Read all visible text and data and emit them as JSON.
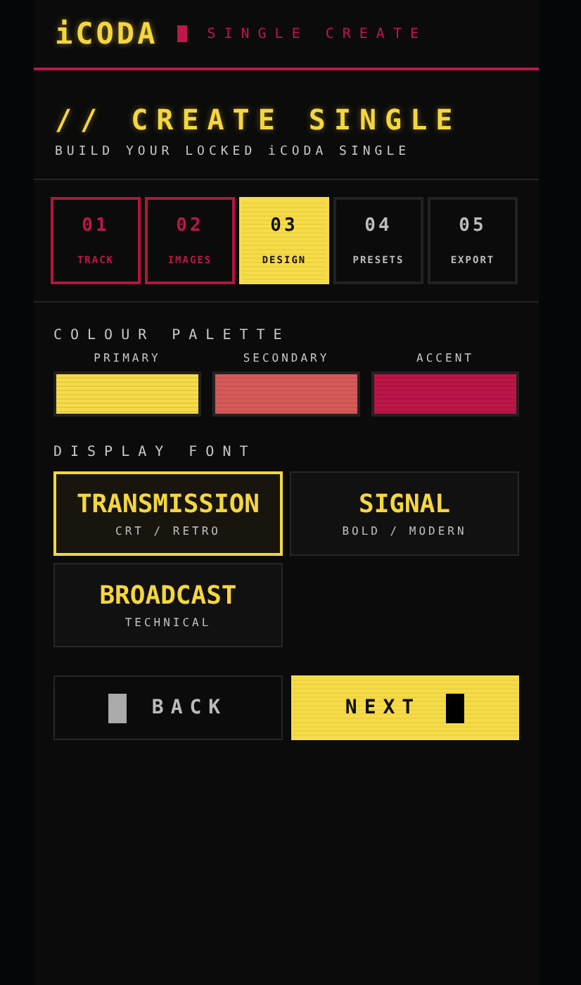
{
  "header": {
    "logo": "iCODA",
    "subtitle": "SINGLE CREATE"
  },
  "page": {
    "title": "// CREATE SINGLE",
    "subtitle": "BUILD YOUR LOCKED iCODA SINGLE"
  },
  "steps": [
    {
      "number": "01",
      "label": "TRACK",
      "done": true,
      "selected": false
    },
    {
      "number": "02",
      "label": "IMAGES",
      "done": true,
      "selected": false
    },
    {
      "number": "03",
      "label": "DESIGN",
      "done": false,
      "selected": true
    },
    {
      "number": "04",
      "label": "PRESETS",
      "done": false,
      "selected": false
    },
    {
      "number": "05",
      "label": "EXPORT",
      "done": false,
      "selected": false
    }
  ],
  "palette": {
    "label": "COLOUR PALETTE",
    "swatches": [
      {
        "name": "PRIMARY",
        "color": "#f7dc4a"
      },
      {
        "name": "SECONDARY",
        "color": "#d65a59"
      },
      {
        "name": "ACCENT",
        "color": "#bc1548"
      }
    ]
  },
  "fonts": {
    "label": "DISPLAY FONT",
    "options": [
      {
        "name": "TRANSMISSION",
        "style": "CRT / RETRO",
        "selected": true
      },
      {
        "name": "SIGNAL",
        "style": "BOLD / MODERN",
        "selected": false
      },
      {
        "name": "BROADCAST",
        "style": "TECHNICAL",
        "selected": false
      }
    ]
  },
  "buttons": [
    {
      "kind": "back",
      "label": "BACK"
    },
    {
      "kind": "next",
      "label": "NEXT"
    }
  ]
}
